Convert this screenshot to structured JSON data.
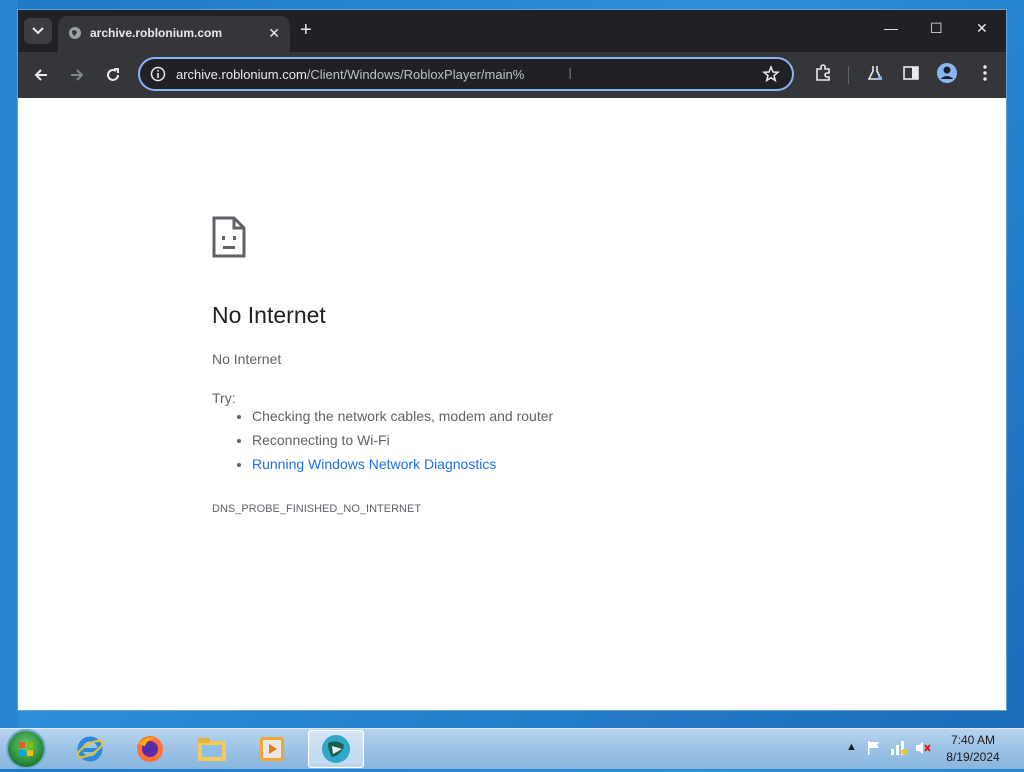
{
  "browser": {
    "tab_title": "archive.roblonium.com",
    "url_host": "archive.roblonium.com",
    "url_path": "/Client/Windows/RobloxPlayer/main%"
  },
  "error": {
    "title": "No Internet",
    "subtitle": "No Internet",
    "try_label": "Try:",
    "suggestions": [
      "Checking the network cables, modem and router",
      "Reconnecting to Wi-Fi"
    ],
    "diagnostics_link": "Running Windows Network Diagnostics",
    "code": "DNS_PROBE_FINISHED_NO_INTERNET"
  },
  "taskbar": {
    "apps": [
      "internet-explorer-icon",
      "firefox-icon",
      "file-explorer-icon",
      "media-player-icon",
      "app-icon"
    ],
    "time": "7:40 AM",
    "date": "8/19/2024"
  },
  "colors": {
    "accent": "#8ab4f8",
    "link": "#1a73e8",
    "chrome_dark": "#202124"
  }
}
